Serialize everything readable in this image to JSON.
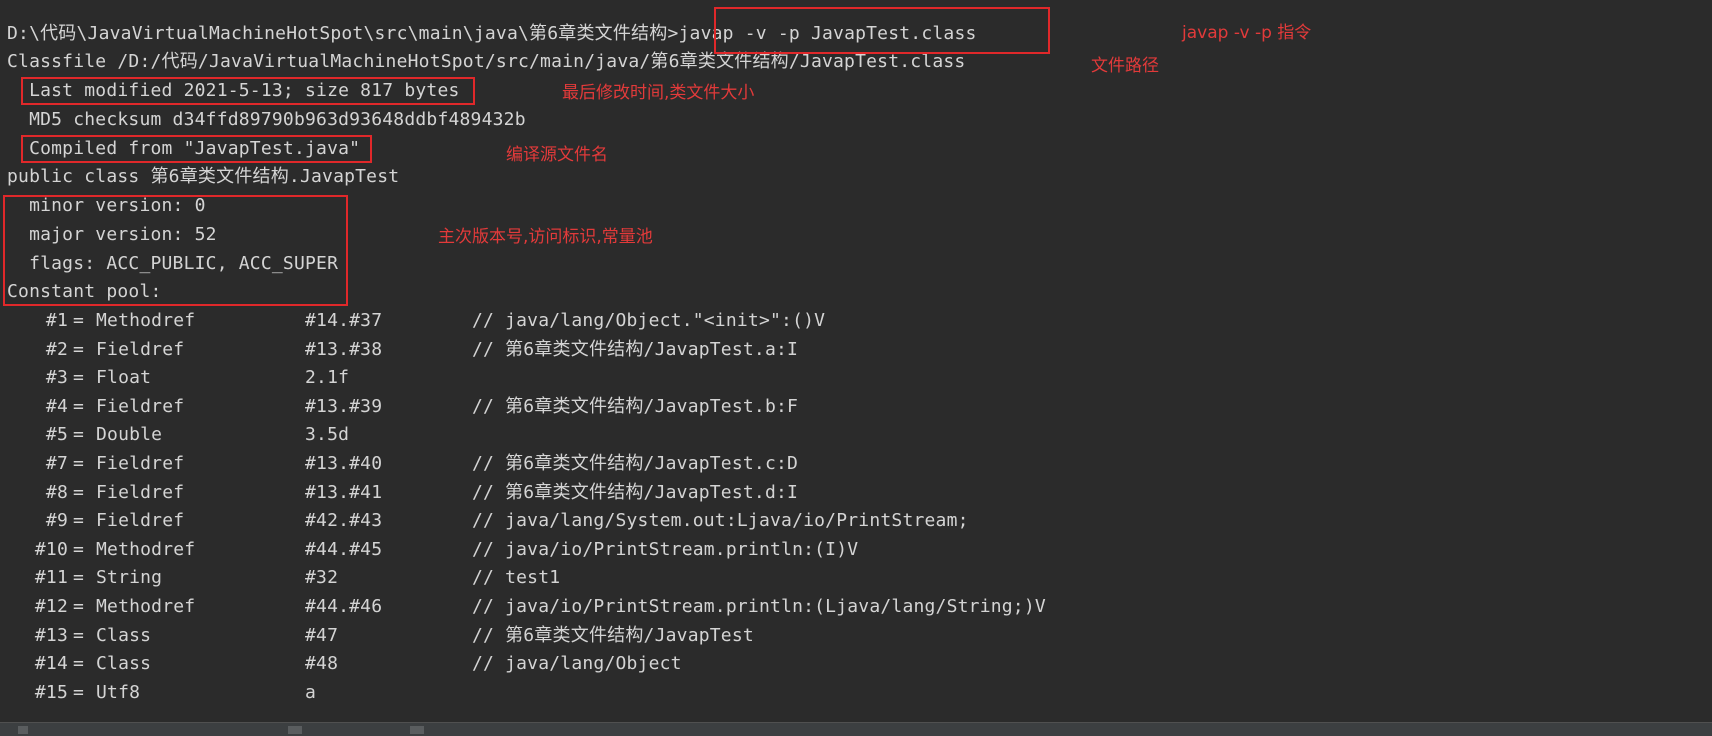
{
  "terminal": {
    "prompt_path": "D:\\代码\\JavaVirtualMachineHotSpot\\src\\main\\java\\第6章类文件结构",
    "prompt_sep": ">",
    "command": "javap -v -p JavapTest.class",
    "classfile": "Classfile /D:/代码/JavaVirtualMachineHotSpot/src/main/java/第6章类文件结构/JavapTest.class",
    "last_modified": "  Last modified 2021-5-13; size 817 bytes",
    "md5": "  MD5 checksum d34ffd89790b963d93648ddbf489432b",
    "compiled_from": "  Compiled from \"JavapTest.java\"",
    "class_decl": "public class 第6章类文件结构.JavapTest",
    "minor_version": "  minor version: 0",
    "major_version": "  major version: 52",
    "flags": "  flags: ACC_PUBLIC, ACC_SUPER",
    "constant_pool_header": "Constant pool:",
    "constant_pool": [
      {
        "idx": "#1",
        "eq": "=",
        "type": "Methodref",
        "ref": "#14.#37",
        "comment": "// java/lang/Object.\"<init>\":()V"
      },
      {
        "idx": "#2",
        "eq": "=",
        "type": "Fieldref",
        "ref": "#13.#38",
        "comment": "// 第6章类文件结构/JavapTest.a:I"
      },
      {
        "idx": "#3",
        "eq": "=",
        "type": "Float",
        "ref": "2.1f",
        "comment": ""
      },
      {
        "idx": "#4",
        "eq": "=",
        "type": "Fieldref",
        "ref": "#13.#39",
        "comment": "// 第6章类文件结构/JavapTest.b:F"
      },
      {
        "idx": "#5",
        "eq": "=",
        "type": "Double",
        "ref": "3.5d",
        "comment": ""
      },
      {
        "idx": "#7",
        "eq": "=",
        "type": "Fieldref",
        "ref": "#13.#40",
        "comment": "// 第6章类文件结构/JavapTest.c:D"
      },
      {
        "idx": "#8",
        "eq": "=",
        "type": "Fieldref",
        "ref": "#13.#41",
        "comment": "// 第6章类文件结构/JavapTest.d:I"
      },
      {
        "idx": "#9",
        "eq": "=",
        "type": "Fieldref",
        "ref": "#42.#43",
        "comment": "// java/lang/System.out:Ljava/io/PrintStream;"
      },
      {
        "idx": "#10",
        "eq": "=",
        "type": "Methodref",
        "ref": "#44.#45",
        "comment": "// java/io/PrintStream.println:(I)V"
      },
      {
        "idx": "#11",
        "eq": "=",
        "type": "String",
        "ref": "#32",
        "comment": "// test1"
      },
      {
        "idx": "#12",
        "eq": "=",
        "type": "Methodref",
        "ref": "#44.#46",
        "comment": "// java/io/PrintStream.println:(Ljava/lang/String;)V"
      },
      {
        "idx": "#13",
        "eq": "=",
        "type": "Class",
        "ref": "#47",
        "comment": "// 第6章类文件结构/JavapTest"
      },
      {
        "idx": "#14",
        "eq": "=",
        "type": "Class",
        "ref": "#48",
        "comment": "// java/lang/Object"
      },
      {
        "idx": "#15",
        "eq": "=",
        "type": "Utf8",
        "ref": "a",
        "comment": ""
      }
    ]
  },
  "annotations": {
    "command_note": "javap -v -p 指令",
    "path_note": "文件路径",
    "modified_note": "最后修改时间,类文件大小",
    "source_note": "编译源文件名",
    "version_note": "主次版本号,访问标识,常量池"
  },
  "colors": {
    "background": "#2b2b2b",
    "text": "#d4d4d4",
    "annotation": "#e23a3a"
  }
}
